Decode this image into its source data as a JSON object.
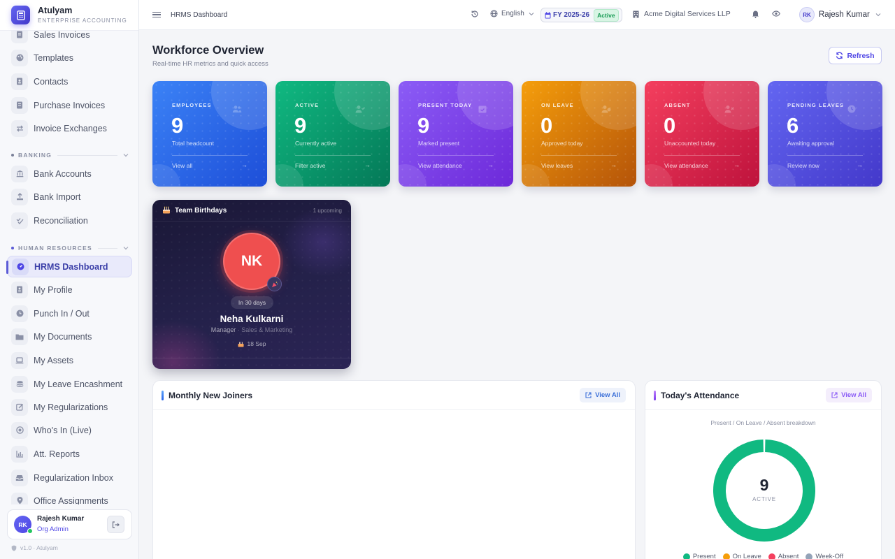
{
  "brand": {
    "name": "Atulyam",
    "subtitle": "ENTERPRISE ACCOUNTING"
  },
  "sidebar": {
    "items_top": [
      {
        "label": "Sales Invoices",
        "icon": "document-icon"
      },
      {
        "label": "Templates",
        "icon": "palette-icon"
      },
      {
        "label": "Contacts",
        "icon": "contacts-icon"
      },
      {
        "label": "Purchase Invoices",
        "icon": "document-icon"
      },
      {
        "label": "Invoice Exchanges",
        "icon": "exchange-icon"
      }
    ],
    "section_banking": "BANKING",
    "items_banking": [
      {
        "label": "Bank Accounts",
        "icon": "bank-icon"
      },
      {
        "label": "Bank Import",
        "icon": "upload-icon"
      },
      {
        "label": "Reconciliation",
        "icon": "check-double-icon"
      }
    ],
    "section_hr": "HUMAN RESOURCES",
    "items_hr": [
      {
        "label": "HRMS Dashboard",
        "icon": "dashboard-icon",
        "active": true
      },
      {
        "label": "My Profile",
        "icon": "profile-icon"
      },
      {
        "label": "Punch In / Out",
        "icon": "clock-icon"
      },
      {
        "label": "My Documents",
        "icon": "folder-icon"
      },
      {
        "label": "My Assets",
        "icon": "laptop-icon"
      },
      {
        "label": "My Leave Encashment",
        "icon": "coins-icon"
      },
      {
        "label": "My Regularizations",
        "icon": "edit-icon"
      },
      {
        "label": "Who's In (Live)",
        "icon": "live-icon"
      },
      {
        "label": "Att. Reports",
        "icon": "chart-icon"
      },
      {
        "label": "Regularization Inbox",
        "icon": "inbox-icon"
      },
      {
        "label": "Office Assignments",
        "icon": "pin-icon"
      }
    ],
    "user": {
      "initials": "RK",
      "name": "Rajesh Kumar",
      "role": "Org Admin"
    },
    "version": "v1.0 · Atulyam"
  },
  "topbar": {
    "breadcrumb": "HRMS Dashboard",
    "language": "English",
    "fiscal_year": "FY 2025-26",
    "fiscal_status": "Active",
    "company": "Acme Digital Services LLP",
    "user_initials": "RK",
    "user_name": "Rajesh Kumar"
  },
  "header": {
    "title": "Workforce Overview",
    "subtitle": "Real-time HR metrics and quick access",
    "refresh_label": "Refresh"
  },
  "stats": [
    {
      "label": "EMPLOYEES",
      "value": "9",
      "desc": "Total headcount",
      "link": "View all",
      "color_from": "#3b82f6",
      "color_to": "#1d4ed8"
    },
    {
      "label": "ACTIVE",
      "value": "9",
      "desc": "Currently active",
      "link": "Filter active",
      "color_from": "#10b981",
      "color_to": "#047857"
    },
    {
      "label": "PRESENT TODAY",
      "value": "9",
      "desc": "Marked present",
      "link": "View attendance",
      "color_from": "#8b5cf6",
      "color_to": "#6d28d9"
    },
    {
      "label": "ON LEAVE",
      "value": "0",
      "desc": "Approved today",
      "link": "View leaves",
      "color_from": "#f59e0b",
      "color_to": "#b45309"
    },
    {
      "label": "ABSENT",
      "value": "0",
      "desc": "Unaccounted today",
      "link": "View attendance",
      "color_from": "#f43f5e",
      "color_to": "#be123c"
    },
    {
      "label": "PENDING LEAVES",
      "value": "6",
      "desc": "Awaiting approval",
      "link": "Review now",
      "color_from": "#6366f1",
      "color_to": "#4338ca"
    }
  ],
  "birthdays": {
    "title": "Team Birthdays",
    "count": "1 upcoming",
    "initials": "NK",
    "in_days": "In 30 days",
    "name": "Neha Kulkarni",
    "role": "Manager",
    "department": "· Sales & Marketing",
    "date": "18 Sep"
  },
  "joiners": {
    "title": "Monthly New Joiners",
    "view_all": "View All"
  },
  "attendance": {
    "title": "Today's Attendance",
    "view_all": "View All",
    "subtitle": "Present / On Leave / Absent breakdown",
    "center_value": "9",
    "center_label": "ACTIVE",
    "present": 9,
    "on_leave": 0,
    "absent": 0,
    "week_off": 0,
    "legend": [
      {
        "label": "Present",
        "color": "#10b981"
      },
      {
        "label": "On Leave",
        "color": "#f59e0b"
      },
      {
        "label": "Absent",
        "color": "#f43f5e"
      },
      {
        "label": "Week-Off",
        "color": "#94a3b8"
      }
    ]
  },
  "colors": {
    "accent": "#4f46e5",
    "present": "#10b981"
  }
}
